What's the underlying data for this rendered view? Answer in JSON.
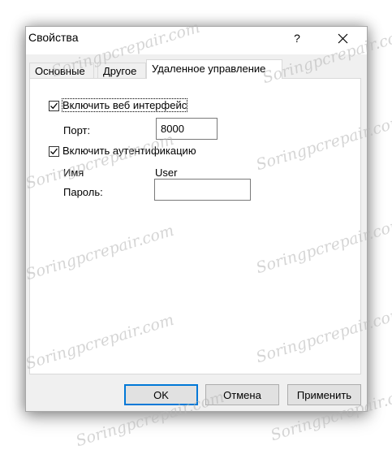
{
  "dialog": {
    "title": "Свойства",
    "help_label": "?"
  },
  "tabs": [
    {
      "label": "Основные"
    },
    {
      "label": "Другое"
    },
    {
      "label": "Удаленное управление"
    }
  ],
  "remote": {
    "enable_web_label": "Включить веб интерфейс",
    "enable_web_checked": true,
    "port_label": "Порт:",
    "port_value": "8000",
    "enable_auth_label": "Включить аутентификацию",
    "enable_auth_checked": true,
    "name_label": "Имя",
    "name_value": "User",
    "password_label": "Пароль:",
    "password_value": ""
  },
  "buttons": {
    "ok": "OK",
    "cancel": "Отмена",
    "apply": "Применить"
  },
  "watermark": "Soringpcrepair.com",
  "colors": {
    "accent": "#0078d7",
    "tab_background": "#f0f0f0",
    "panel_background": "#ffffff"
  },
  "icons": {
    "close": "close-icon",
    "check": "checkmark-icon"
  }
}
